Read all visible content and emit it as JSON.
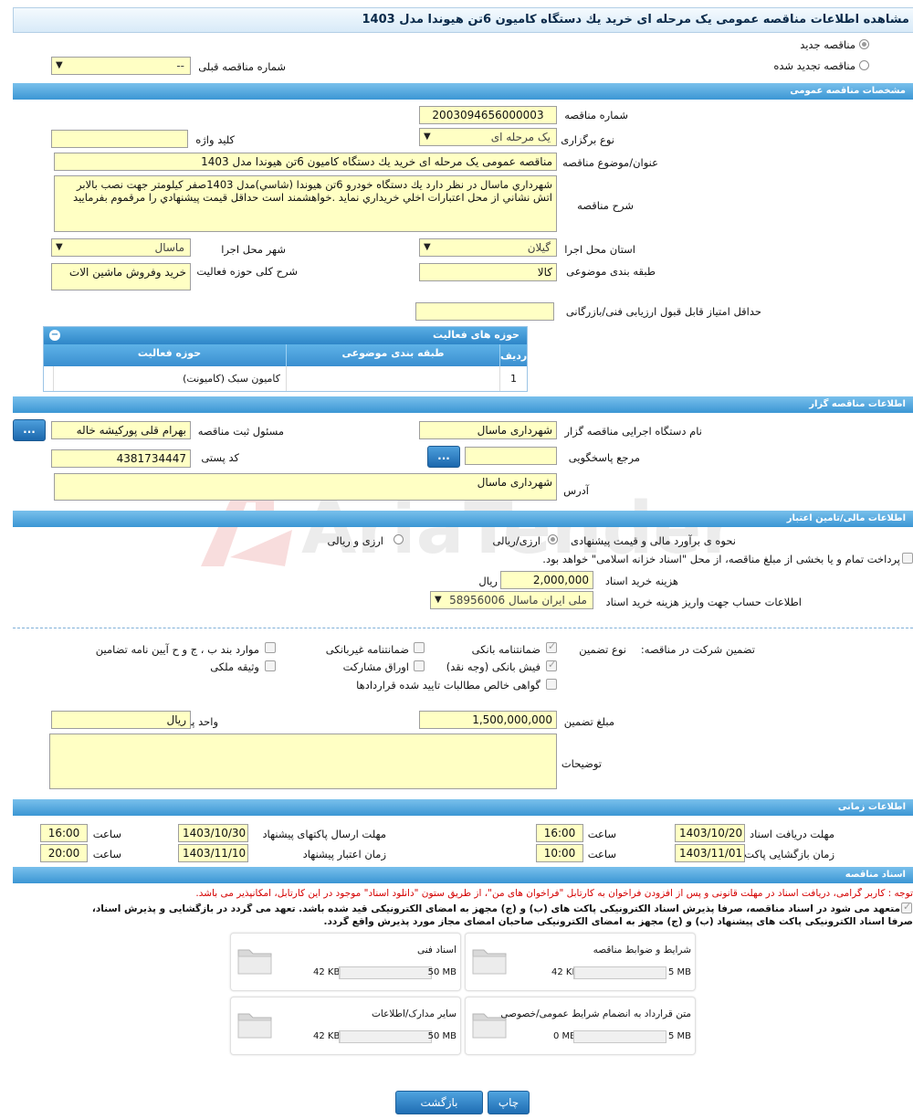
{
  "page_title": "مشاهده اطلاعات مناقصه عمومی یک مرحله ای خرید یك دستگاه کامیون 6تن هیوندا مدل 1403",
  "tender_type": {
    "new_label": "مناقصه جدید",
    "renewed_label": "مناقصه تجدید شده",
    "prev_number_label": "شماره مناقصه قبلی",
    "prev_number_value": "--"
  },
  "general": {
    "section_title": "مشخصات مناقصه عمومی",
    "number_label": "شماره مناقصه",
    "number_value": "2003094656000003",
    "holding_type_label": "نوع برگزاری",
    "holding_type_value": "یک مرحله ای",
    "keyword_label": "کلید واژه",
    "keyword_value": "",
    "subject_label": "عنوان/موضوع مناقصه",
    "subject_value": "مناقصه عمومی یک مرحله ای خرید یك دستگاه کامیون 6تن هیوندا مدل 1403",
    "description_label": "شرح مناقصه",
    "description_value": "شهرداري ماسال در نظر دارد يك دستگاه خودرو 6تن  هیوندا (شاسي)مدل 1403صفر کیلومتر جهت نصب بالابر اتش نشاني از محل اعتبارات اخلي خريداري نمايد .خواهشمند است حداقل قيمت پيشنهادي را مرقموم بفرماييد",
    "province_label": "استان محل اجرا",
    "province_value": "گیلان",
    "city_label": "شهر محل اجرا",
    "city_value": "ماسال",
    "category_label": "طبقه بندی موضوعی",
    "category_value": "کالا",
    "activity_desc_label": "شرح کلی حوزه فعالیت",
    "activity_desc_value": "خرید وفروش ماشین الات",
    "min_score_label": "حداقل امتیاز قابل قبول ارزیابی فنی/بازرگانی",
    "min_score_value": ""
  },
  "activity_grid": {
    "title": "حوزه های فعالیت",
    "col_row": "ردیف",
    "col_category": "طبقه بندی موضوعی",
    "col_field": "حوزه فعالیت",
    "rows": [
      {
        "row": "1",
        "category": "",
        "field": "کامیون سبک (کامیونت)"
      }
    ]
  },
  "organizer": {
    "section_title": "اطلاعات مناقصه گزار",
    "org_label": "نام دستگاه اجرایی مناقصه گزار",
    "org_value": "شهرداری ماسال",
    "registrar_label": "مسئول ثبت مناقصه",
    "registrar_value": "بهرام قلی پورکیشه خاله",
    "dots": "...",
    "reference_label": "مرجع پاسخگویی",
    "reference_value": "",
    "postal_label": "کد پستی",
    "postal_value": "4381734447",
    "address_label": "آدرس",
    "address_value": "شهرداری ماسال"
  },
  "finance": {
    "section_title": "اطلاعات مالی/تامین اعتبار",
    "estimate_label": "نحوه ی برآورد مالی و قیمت پیشنهادی",
    "estimate_opt1": "ارزی/ریالی",
    "estimate_opt2": "ارزی و ریالی",
    "treasury_text": "پرداخت تمام و یا بخشی از مبلغ مناقصه، از محل \"اسناد خزانه اسلامی\" خواهد بود.",
    "doc_fee_label": "هزینه خرید اسناد",
    "doc_fee_value": "2,000,000",
    "doc_fee_unit": "ریال",
    "account_label": "اطلاعات حساب جهت واریز هزینه خرید اسناد",
    "account_value": "ملی ایران ماسال 58956006"
  },
  "guarantee": {
    "participation_label": "تضمین شرکت در مناقصه:",
    "type_label": "نوع تضمین",
    "bank_guarantee": "ضمانتنامه بانکی",
    "nonbank_guarantee": "ضمانتنامه غیربانکی",
    "regulation_items": "موارد بند ب ، ج و ح آیین نامه تضامین",
    "bank_receipt": "فیش بانکی (وجه نقد)",
    "participation_bonds": "اوراق مشارکت",
    "property_deed": "وثیقه ملکی",
    "net_claims": "گواهی خالص مطالبات تایید شده قراردادها",
    "amount_label": "مبلغ تضمین",
    "amount_value": "1,500,000,000",
    "currency_label": "واحد پول",
    "currency_value": "ریال",
    "notes_label": "توضیحات",
    "notes_value": ""
  },
  "timing": {
    "section_title": "اطلاعات زمانی",
    "receive_label": "مهلت دریافت اسناد",
    "receive_date": "1403/10/20",
    "receive_time": "16:00",
    "send_label": "مهلت ارسال پاکتهای پیشنهاد",
    "send_date": "1403/10/30",
    "send_time": "16:00",
    "open_label": "زمان بازگشایی پاکت ها",
    "open_date": "1403/11/01",
    "open_time": "10:00",
    "validity_label": "زمان اعتبار پیشنهاد",
    "validity_date": "1403/11/10",
    "validity_time": "20:00",
    "time_label": "ساعت"
  },
  "documents": {
    "section_title": "اسناد مناقصه",
    "notice": "توجه : کاربر گرامی، دریافت اسناد در مهلت قانونی و پس از افزودن فراخوان به کارتابل \"فراخوان های من\"، از طریق ستون \"دانلود اسناد\" موجود در این کارتابل، امکانپذیر می باشد.",
    "commit_line1": "متعهد می شود در اسناد مناقصه، صرفاً پذیرش اسناد الکترونیکی پاکت های (ب) و (ج) مجهز به امضای الکترونیکی قید شده باشد. تعهد می گردد در بازگشایی و پذیرش اسناد،",
    "commit_line2": "صرفاً اسناد الکترونیکی پاکت های پیشنهاد (ب) و (ج) مجهز به امضای الکترونیکی صاحبان امضای مجاز مورد پذیرش واقع گردد.",
    "items": [
      {
        "name": "شرایط و ضوابط مناقصه",
        "size": "42 KB",
        "max": "5 MB",
        "ratio": 0.008
      },
      {
        "name": "اسناد فنی",
        "size": "42 KB",
        "max": "50 MB",
        "ratio": 0.01
      },
      {
        "name": "متن قرارداد به انضمام شرایط عمومی/خصوصی",
        "size": "0 MB",
        "max": "5 MB",
        "ratio": 0.0
      },
      {
        "name": "سایر مدارک/اطلاعات",
        "size": "42 KB",
        "max": "50 MB",
        "ratio": 0.01
      }
    ]
  },
  "footer": {
    "print_label": "چاپ",
    "back_label": "بازگشت"
  },
  "watermark_text": "AriaTender.neT",
  "colors": {
    "section_blue": "#3b96d4",
    "field_yellow": "#ffffc4",
    "notice_red": "#d40000"
  }
}
